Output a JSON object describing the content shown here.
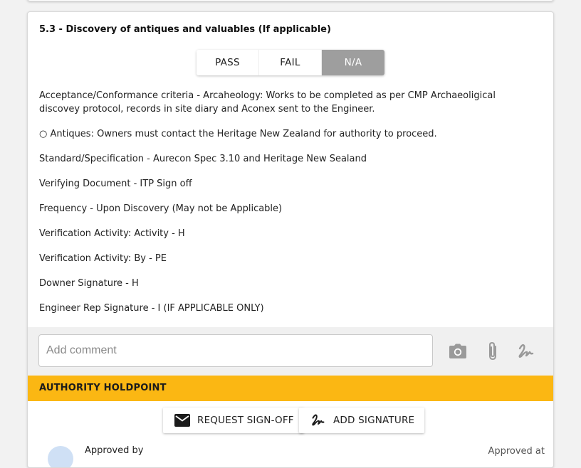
{
  "item": {
    "title": "5.3 - Discovery of antiques and valuables (If applicable)",
    "status_options": [
      "PASS",
      "FAIL",
      "N/A"
    ],
    "selected_status": "N/A",
    "criteria": [
      "Acceptance/Conformance criteria - Arcaheology: Works to be completed as per CMP Archaeoligical discovey protocol, records in site diary and Aconex sent to the Engineer.",
      "○ Antiques: Owners must contact the Heritage New Zealand for authority to proceed.",
      "Standard/Specification - Aurecon Spec 3.10 and Heritage New Sealand",
      "Verifying Document - ITP Sign off",
      "Frequency - Upon Discovery (May not be Applicable)",
      "Verification Activity: Activity - H",
      "Verification Activity: By - PE",
      "Downer Signature - H",
      "Engineer Rep Signature - I (IF APPLICABLE ONLY)"
    ]
  },
  "comment": {
    "placeholder": "Add comment",
    "value": "",
    "icons": [
      "camera-icon",
      "paperclip-icon",
      "signature-icon"
    ]
  },
  "holdpoint": {
    "label": "AUTHORITY HOLDPOINT",
    "color": "#fbb713",
    "request_signoff_label": "REQUEST SIGN-OFF",
    "add_signature_label": "ADD SIGNATURE"
  },
  "approval": {
    "approved_by_label": "Approved by",
    "approved_at_label": "Approved at"
  },
  "colors": {
    "selected_segment": "#9e9e9e",
    "icon_grey": "#9a9a9a"
  }
}
